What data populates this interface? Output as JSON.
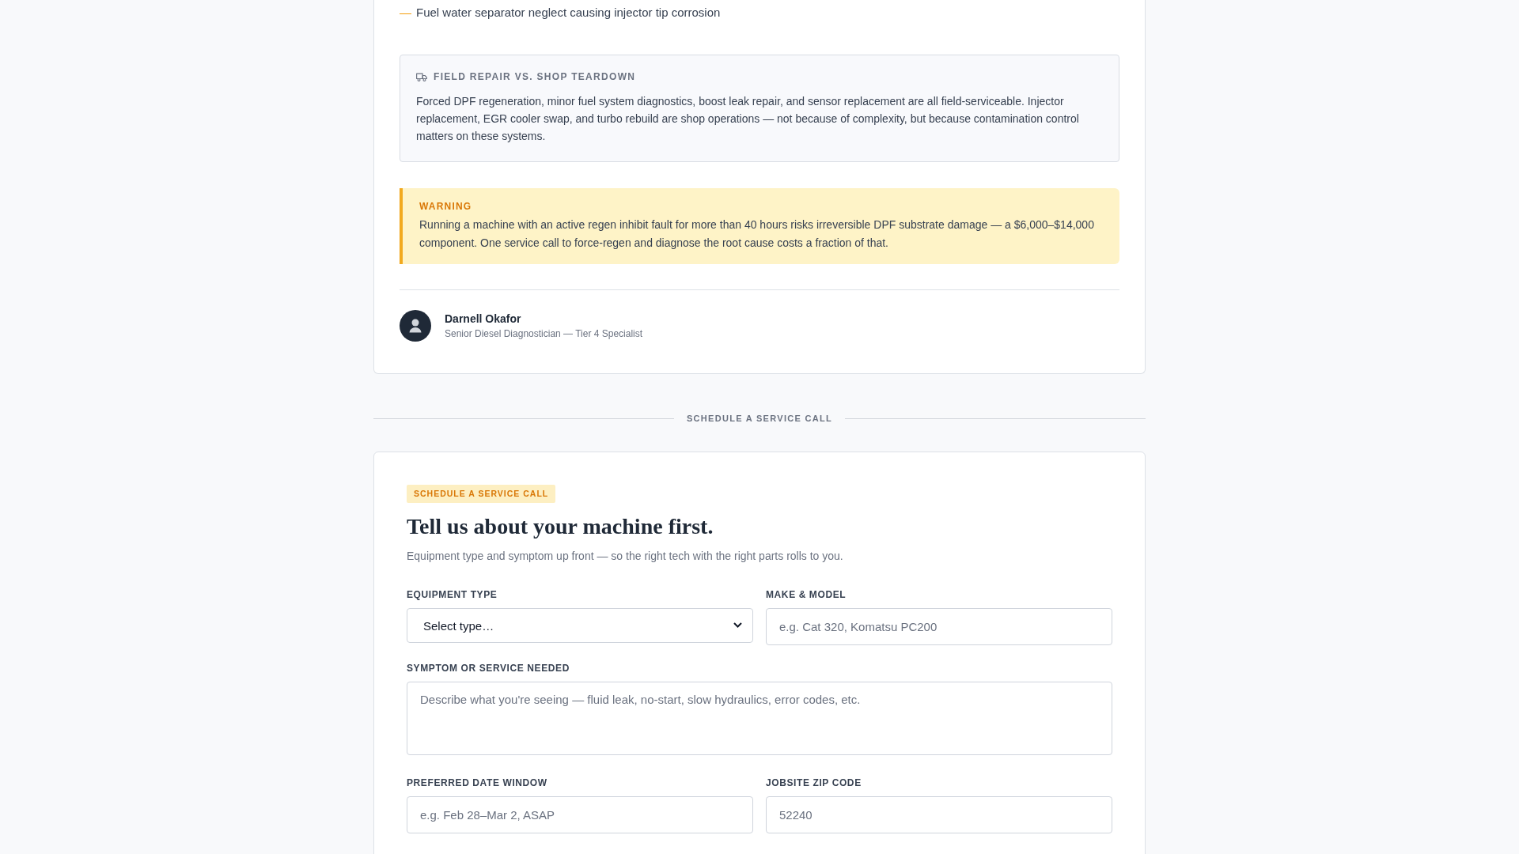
{
  "article": {
    "list_items": [
      {
        "marker": "—",
        "text": "Fuel water separator neglect causing injector tip corrosion"
      }
    ],
    "callout": {
      "title": "FIELD REPAIR VS. SHOP TEARDOWN",
      "body": "Forced DPF regeneration, minor fuel system diagnostics, boost leak repair, and sensor replacement are all field-serviceable. Injector replacement, EGR cooler swap, and turbo rebuild are shop operations — not because of complexity, but because contamination control matters on these systems."
    },
    "warning": {
      "label": "WARNING",
      "body": "Running a machine with an active regen inhibit fault for more than 40 hours risks irreversible DPF substrate damage — a $6,000–$14,000 component. One service call to force-regen and diagnose the root cause costs a fraction of that."
    },
    "author": {
      "name": "Darnell Okafor",
      "role": "Senior Diesel Diagnostician — Tier 4 Specialist"
    }
  },
  "section_divider": {
    "label": "SCHEDULE A SERVICE CALL"
  },
  "form": {
    "badge": "SCHEDULE A SERVICE CALL",
    "title": "Tell us about your machine first.",
    "subtitle": "Equipment type and symptom up front — so the right tech with the right parts rolls to you.",
    "fields": [
      {
        "kind": "select",
        "label": "EQUIPMENT TYPE",
        "value": "Select type…"
      },
      {
        "kind": "text",
        "label": "MAKE & MODEL",
        "placeholder": "e.g. Cat 320, Komatsu PC200"
      },
      {
        "kind": "textarea",
        "label": "SYMPTOM OR SERVICE NEEDED",
        "placeholder": "Describe what you're seeing — fluid leak, no-start, slow hydraulics, error codes, etc."
      },
      {
        "kind": "text",
        "label": "PREFERRED DATE WINDOW",
        "placeholder": "e.g. Feb 28–Mar 2, ASAP"
      },
      {
        "kind": "text",
        "label": "JOBSITE ZIP CODE",
        "placeholder": "52240"
      }
    ]
  }
}
